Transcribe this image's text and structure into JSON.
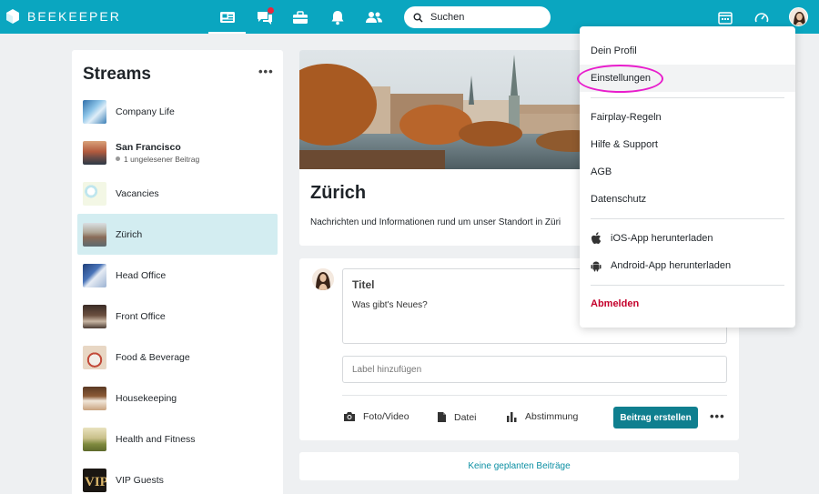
{
  "app": {
    "brand": "BEEKEEPER",
    "accent": "#0aa6c0"
  },
  "nav": {
    "icons": [
      "stream-icon",
      "chat-icon",
      "tools-icon",
      "bell-icon",
      "people-icon"
    ],
    "search_placeholder": "Suchen",
    "right_icons": [
      "calendar-icon",
      "speedometer-icon",
      "avatar"
    ]
  },
  "sidebar": {
    "title": "Streams",
    "more": "•••",
    "items": [
      {
        "name": "Company Life",
        "bold": false
      },
      {
        "name": "San Francisco",
        "bold": true,
        "sub": "1 ungelesener Beitrag"
      },
      {
        "name": "Vacancies",
        "bold": false
      },
      {
        "name": "Zürich",
        "bold": false,
        "active": true
      },
      {
        "name": "Head Office",
        "bold": false
      },
      {
        "name": "Front Office",
        "bold": false
      },
      {
        "name": "Food & Beverage",
        "bold": false
      },
      {
        "name": "Housekeeping",
        "bold": false
      },
      {
        "name": "Health and Fitness",
        "bold": false
      },
      {
        "name": "VIP Guests",
        "bold": false
      }
    ]
  },
  "stream": {
    "title": "Zürich",
    "description": "Nachrichten und Informationen rund um unser Standort in Züri"
  },
  "composer": {
    "title_placeholder": "Titel",
    "body_placeholder": "Was gibt's Neues?",
    "label_placeholder": "Label hinzufügen",
    "actions": {
      "photo": "Foto/Video",
      "file": "Datei",
      "poll": "Abstimmung"
    },
    "post_button": "Beitrag erstellen",
    "more": "•••"
  },
  "scheduled": "Keine geplanten Beiträge",
  "dropdown": {
    "profile": "Dein Profil",
    "settings": "Einstellungen",
    "fairplay": "Fairplay-Regeln",
    "help": "Hilfe & Support",
    "agb": "AGB",
    "privacy": "Datenschutz",
    "ios": "iOS-App herunterladen",
    "android": "Android-App herunterladen",
    "logout": "Abmelden"
  }
}
